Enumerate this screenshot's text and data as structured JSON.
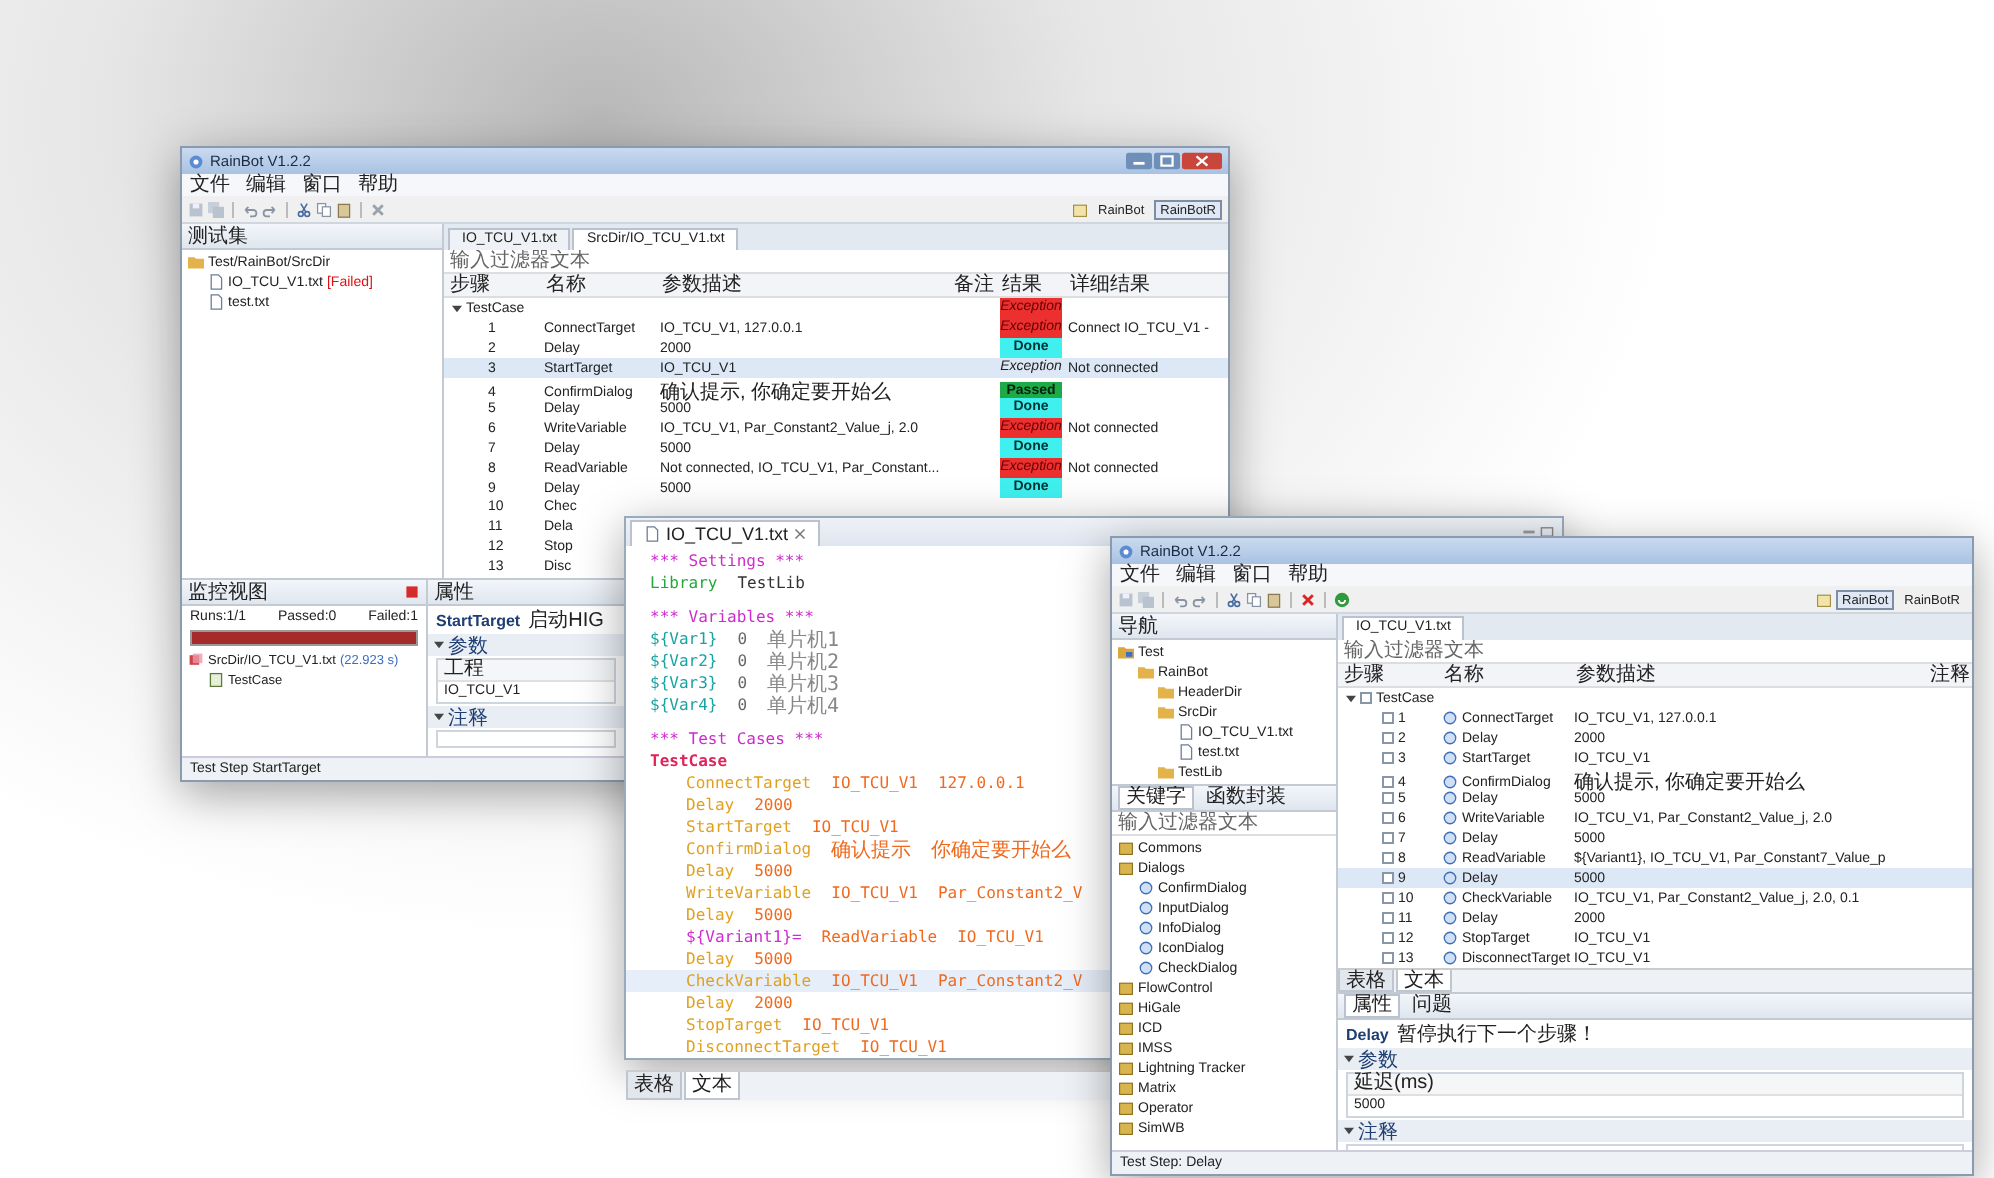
{
  "left_window": {
    "title": "RainBot V1.2.2",
    "menu": [
      "文件",
      "编辑",
      "窗口",
      "帮助"
    ],
    "perspectives": [
      {
        "label": "RainBot",
        "selected": false
      },
      {
        "label": "RainBotR",
        "selected": true
      }
    ],
    "suite_panel": {
      "title": "测试集",
      "tree": [
        {
          "label": "Test/RainBot/SrcDir",
          "kind": "folder",
          "children": [
            {
              "label": "IO_TCU_V1.txt",
              "kind": "file",
              "badge": "[Failed]"
            },
            {
              "label": "test.txt",
              "kind": "file"
            }
          ]
        }
      ]
    },
    "editor_tabs": [
      {
        "label": "IO_TCU_V1.txt",
        "selected": false
      },
      {
        "label": "SrcDir/IO_TCU_V1.txt",
        "selected": true
      }
    ],
    "filter": {
      "placeholder": "输入过滤器文本"
    },
    "table": {
      "columns": [
        "步骤",
        "名称",
        "参数描述",
        "备注",
        "结果",
        "详细结果"
      ],
      "rows": [
        {
          "step": "TestCase",
          "expanded": true,
          "selected": false,
          "result": "Exception",
          "kind": "exception"
        },
        {
          "step": "1",
          "name": "ConnectTarget",
          "params": "IO_TCU_V1, 127.0.0.1",
          "result": "Exception",
          "kind": "exception",
          "detail": "Connect IO_TCU_V1 -",
          "selected": false
        },
        {
          "step": "2",
          "name": "Delay",
          "params": "2000",
          "result": "Done",
          "kind": "done",
          "selected": false
        },
        {
          "step": "3",
          "name": "StartTarget",
          "params": "IO_TCU_V1",
          "result": "Exception",
          "kind": "exception",
          "detail": "Not connected",
          "selected": true
        },
        {
          "step": "4",
          "name": "ConfirmDialog",
          "params": "确认提示, 你确定要开始么",
          "result": "Passed",
          "kind": "passed",
          "selected": false
        },
        {
          "step": "5",
          "name": "Delay",
          "params": "5000",
          "result": "Done",
          "kind": "done",
          "selected": false
        },
        {
          "step": "6",
          "name": "WriteVariable",
          "params": "IO_TCU_V1, Par_Constant2_Value_j, 2.0",
          "result": "Exception",
          "kind": "exception",
          "detail": "Not connected",
          "selected": false
        },
        {
          "step": "7",
          "name": "Delay",
          "params": "5000",
          "result": "Done",
          "kind": "done",
          "selected": false
        },
        {
          "step": "8",
          "name": "ReadVariable",
          "params": "Not connected, IO_TCU_V1, Par_Constant...",
          "result": "Exception",
          "kind": "exception",
          "detail": "Not connected",
          "selected": false
        },
        {
          "step": "9",
          "name": "Delay",
          "params": "5000",
          "result": "Done",
          "kind": "done",
          "selected": false
        },
        {
          "step": "10",
          "name": "Chec",
          "selected": false
        },
        {
          "step": "11",
          "name": "Dela",
          "selected": false
        },
        {
          "step": "12",
          "name": "Stop",
          "selected": false
        },
        {
          "step": "13",
          "name": "Disc",
          "selected": false
        }
      ]
    },
    "monitor": {
      "title": "监控视图",
      "runs": "Runs:1/1",
      "passed": "Passed:0",
      "failed": "Failed:1",
      "level": 1,
      "tree": [
        {
          "label": "SrcDir/IO_TCU_V1.txt",
          "kind": "suite",
          "time": "(22.923 s)",
          "children": [
            {
              "label": "TestCase",
              "kind": "case"
            }
          ]
        }
      ]
    },
    "properties": {
      "tab": "属性",
      "step": "StartTarget",
      "description": "启动HIG",
      "sections": [
        {
          "title": "参数",
          "expanded": true,
          "fields": [
            {
              "label": "工程",
              "value": "IO_TCU_V1"
            }
          ]
        },
        {
          "title": "注释",
          "expanded": true
        }
      ]
    },
    "status_bar": "Test Step StartTarget"
  },
  "middle_window": {
    "tab": "IO_TCU_V1.txt",
    "blocks": [
      {
        "lines": [
          {
            "highlighted": false,
            "tokens": [
              {
                "kind": "section",
                "text": "*** Settings ***"
              }
            ]
          },
          {
            "highlighted": false,
            "tokens": [
              {
                "kind": "setting",
                "text": "Library"
              },
              {
                "kind": "name",
                "text": "TestLib"
              }
            ]
          }
        ]
      },
      {
        "lines": [
          {
            "highlighted": false,
            "tokens": [
              {
                "kind": "section",
                "text": "*** Variables ***"
              }
            ]
          },
          {
            "highlighted": false,
            "tokens": [
              {
                "kind": "variable",
                "text": "${Var1}"
              },
              {
                "kind": "value",
                "text": "0"
              },
              {
                "kind": "comment",
                "text": "单片机1"
              }
            ]
          },
          {
            "highlighted": false,
            "tokens": [
              {
                "kind": "variable",
                "text": "${Var2}"
              },
              {
                "kind": "value",
                "text": "0"
              },
              {
                "kind": "comment",
                "text": "单片机2"
              }
            ]
          },
          {
            "highlighted": false,
            "tokens": [
              {
                "kind": "variable",
                "text": "${Var3}"
              },
              {
                "kind": "value",
                "text": "0"
              },
              {
                "kind": "comment",
                "text": "单片机3"
              }
            ]
          },
          {
            "highlighted": false,
            "tokens": [
              {
                "kind": "variable",
                "text": "${Var4}"
              },
              {
                "kind": "value",
                "text": "0"
              },
              {
                "kind": "comment",
                "text": "单片机4"
              }
            ]
          }
        ]
      },
      {
        "lines": [
          {
            "highlighted": false,
            "tokens": [
              {
                "kind": "section",
                "text": "*** Test Cases ***"
              }
            ]
          },
          {
            "highlighted": false,
            "tokens": [
              {
                "kind": "testcase",
                "text": "TestCase"
              }
            ],
            "children": [
              {
                "highlighted": false,
                "tokens": [
                  {
                    "kind": "keyword",
                    "text": "ConnectTarget"
                  },
                  {
                    "kind": "arg",
                    "text": "IO_TCU_V1"
                  },
                  {
                    "kind": "arg",
                    "text": "127.0.0.1"
                  }
                ]
              },
              {
                "highlighted": false,
                "tokens": [
                  {
                    "kind": "keyword",
                    "text": "Delay"
                  },
                  {
                    "kind": "arg",
                    "text": "2000"
                  }
                ]
              },
              {
                "highlighted": false,
                "tokens": [
                  {
                    "kind": "keyword",
                    "text": "StartTarget"
                  },
                  {
                    "kind": "arg",
                    "text": "IO_TCU_V1"
                  }
                ]
              },
              {
                "highlighted": false,
                "tokens": [
                  {
                    "kind": "keyword",
                    "text": "ConfirmDialog"
                  },
                  {
                    "kind": "arg",
                    "text": "确认提示"
                  },
                  {
                    "kind": "arg",
                    "text": "你确定要开始么"
                  }
                ]
              },
              {
                "highlighted": false,
                "tokens": [
                  {
                    "kind": "keyword",
                    "text": "Delay"
                  },
                  {
                    "kind": "arg",
                    "text": "5000"
                  }
                ]
              },
              {
                "highlighted": false,
                "tokens": [
                  {
                    "kind": "keyword",
                    "text": "WriteVariable"
                  },
                  {
                    "kind": "arg",
                    "text": "IO_TCU_V1"
                  },
                  {
                    "kind": "arg",
                    "text": "Par_Constant2_V"
                  }
                ]
              },
              {
                "highlighted": false,
                "tokens": [
                  {
                    "kind": "keyword",
                    "text": "Delay"
                  },
                  {
                    "kind": "arg",
                    "text": "5000"
                  }
                ]
              },
              {
                "highlighted": false,
                "tokens": [
                  {
                    "kind": "assign",
                    "text": "${Variant1}="
                  },
                  {
                    "kind": "arg",
                    "text": "ReadVariable"
                  },
                  {
                    "kind": "arg",
                    "text": "IO_TCU_V1"
                  }
                ]
              },
              {
                "highlighted": false,
                "tokens": [
                  {
                    "kind": "keyword",
                    "text": "Delay"
                  },
                  {
                    "kind": "arg",
                    "text": "5000"
                  }
                ]
              },
              {
                "highlighted": true,
                "tokens": [
                  {
                    "kind": "keyword",
                    "text": "CheckVariable"
                  },
                  {
                    "kind": "arg",
                    "text": "IO_TCU_V1"
                  },
                  {
                    "kind": "arg",
                    "text": "Par_Constant2_V"
                  }
                ]
              },
              {
                "highlighted": false,
                "tokens": [
                  {
                    "kind": "keyword",
                    "text": "Delay"
                  },
                  {
                    "kind": "arg",
                    "text": "2000"
                  }
                ]
              },
              {
                "highlighted": false,
                "tokens": [
                  {
                    "kind": "keyword",
                    "text": "StopTarget"
                  },
                  {
                    "kind": "arg",
                    "text": "IO_TCU_V1"
                  }
                ]
              },
              {
                "highlighted": false,
                "tokens": [
                  {
                    "kind": "keyword",
                    "text": "DisconnectTarget"
                  },
                  {
                    "kind": "arg",
                    "text": "IO_TCU_V1"
                  }
                ]
              }
            ]
          }
        ]
      }
    ],
    "bottom_tabs": [
      {
        "label": "表格",
        "selected": false
      },
      {
        "label": "文本",
        "selected": true
      }
    ]
  },
  "right_window": {
    "title": "RainBot V1.2.2",
    "menu": [
      "文件",
      "编辑",
      "窗口",
      "帮助"
    ],
    "perspectives": [
      {
        "label": "RainBot",
        "selected": true
      },
      {
        "label": "RainBotR",
        "selected": false
      }
    ],
    "navigator": {
      "title": "导航",
      "tree": [
        {
          "label": "Test",
          "kind": "project",
          "children": [
            {
              "label": "RainBot",
              "kind": "folder",
              "children": [
                {
                  "label": "HeaderDir",
                  "kind": "folder"
                },
                {
                  "label": "SrcDir",
                  "kind": "folder",
                  "children": [
                    {
                      "label": "IO_TCU_V1.txt",
                      "kind": "file"
                    },
                    {
                      "label": "test.txt",
                      "kind": "file"
                    }
                  ]
                },
                {
                  "label": "TestLib",
                  "kind": "folder"
                }
              ]
            }
          ]
        }
      ]
    },
    "keyword_tabs": [
      {
        "label": "关键字",
        "selected": true
      },
      {
        "label": "函数封装",
        "selected": false
      }
    ],
    "keyword_filter": {
      "placeholder": "输入过滤器文本"
    },
    "keywords": [
      {
        "label": "Commons",
        "kind": "library"
      },
      {
        "label": "Dialogs",
        "kind": "library",
        "children": [
          {
            "label": "ConfirmDialog",
            "kind": "keyword"
          },
          {
            "label": "InputDialog",
            "kind": "keyword"
          },
          {
            "label": "InfoDialog",
            "kind": "keyword"
          },
          {
            "label": "IconDialog",
            "kind": "keyword"
          },
          {
            "label": "CheckDialog",
            "kind": "keyword"
          }
        ]
      },
      {
        "label": "FlowControl",
        "kind": "library"
      },
      {
        "label": "HiGale",
        "kind": "library"
      },
      {
        "label": "ICD",
        "kind": "library"
      },
      {
        "label": "IMSS",
        "kind": "library"
      },
      {
        "label": "Lightning Tracker",
        "kind": "library"
      },
      {
        "label": "Matrix",
        "kind": "library"
      },
      {
        "label": "Operator",
        "kind": "library"
      },
      {
        "label": "SimWB",
        "kind": "library"
      }
    ],
    "editor_tab": "IO_TCU_V1.txt",
    "filter": {
      "placeholder": "输入过滤器文本"
    },
    "table": {
      "columns": [
        "步骤",
        "名称",
        "参数描述",
        "注释"
      ],
      "rows": [
        {
          "step": "TestCase",
          "expanded": true,
          "checked": false,
          "selected": false
        },
        {
          "step": "1",
          "name": "ConnectTarget",
          "params": "IO_TCU_V1, 127.0.0.1",
          "checked": false,
          "selected": false
        },
        {
          "step": "2",
          "name": "Delay",
          "params": "2000",
          "checked": false,
          "selected": false
        },
        {
          "step": "3",
          "name": "StartTarget",
          "params": "IO_TCU_V1",
          "checked": false,
          "selected": false
        },
        {
          "step": "4",
          "name": "ConfirmDialog",
          "params": "确认提示, 你确定要开始么",
          "checked": false,
          "selected": false
        },
        {
          "step": "5",
          "name": "Delay",
          "params": "5000",
          "checked": false,
          "selected": false
        },
        {
          "step": "6",
          "name": "WriteVariable",
          "params": "IO_TCU_V1, Par_Constant2_Value_j, 2.0",
          "checked": false,
          "selected": false
        },
        {
          "step": "7",
          "name": "Delay",
          "params": "5000",
          "checked": false,
          "selected": false
        },
        {
          "step": "8",
          "name": "ReadVariable",
          "params": "${Variant1}, IO_TCU_V1, Par_Constant7_Value_p",
          "checked": false,
          "selected": false
        },
        {
          "step": "9",
          "name": "Delay",
          "params": "5000",
          "checked": false,
          "selected": true
        },
        {
          "step": "10",
          "name": "CheckVariable",
          "params": "IO_TCU_V1, Par_Constant2_Value_j, 2.0, 0.1",
          "checked": false,
          "selected": false
        },
        {
          "step": "11",
          "name": "Delay",
          "params": "2000",
          "checked": false,
          "selected": false
        },
        {
          "step": "12",
          "name": "StopTarget",
          "params": "IO_TCU_V1",
          "checked": false,
          "selected": false
        },
        {
          "step": "13",
          "name": "DisconnectTarget",
          "params": "IO_TCU_V1",
          "checked": false,
          "selected": false
        }
      ]
    },
    "bottom_tabs": [
      {
        "label": "表格",
        "selected": false
      },
      {
        "label": "文本",
        "selected": true
      }
    ],
    "property_tabs": [
      {
        "label": "属性",
        "selected": true
      },
      {
        "label": "问题",
        "selected": false
      }
    ],
    "properties": {
      "step": "Delay",
      "description": "暂停执行下一个步骤！",
      "sections": [
        {
          "title": "参数",
          "expanded": true,
          "fields": [
            {
              "label": "延迟(ms)",
              "value": "5000"
            }
          ]
        },
        {
          "title": "注释",
          "expanded": true
        }
      ]
    },
    "status_bar": "Test Step: Delay"
  }
}
